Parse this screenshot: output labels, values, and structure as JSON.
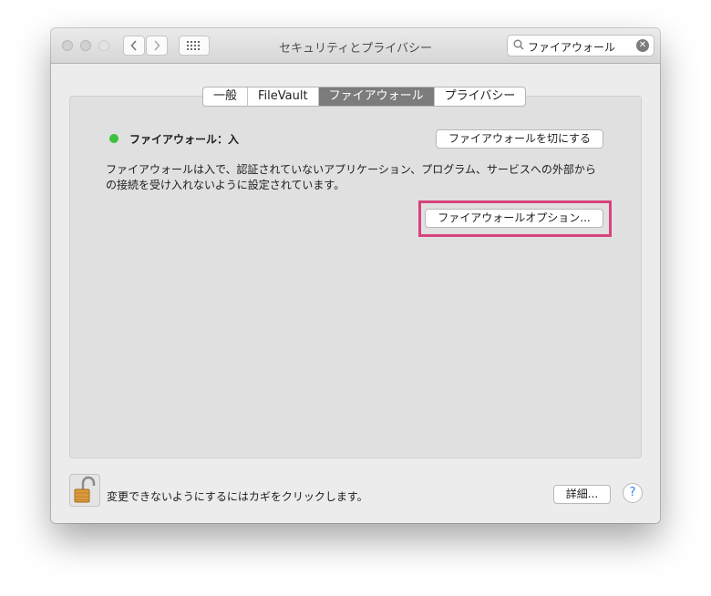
{
  "window": {
    "title": "セキュリティとプライバシー"
  },
  "search": {
    "value": "ファイアウォール"
  },
  "tabs": [
    {
      "label": "一般"
    },
    {
      "label": "FileVault"
    },
    {
      "label": "ファイアウォール",
      "active": true
    },
    {
      "label": "プライバシー"
    }
  ],
  "firewall": {
    "status": "ファイアウォール：入",
    "status_color": "#3ec13f",
    "toggle_button": "ファイアウォールを切にする",
    "description": "ファイアウォールは入で、認証されていないアプリケーション、プログラム、サービスへの外部からの接続を受け入れないように設定されています。",
    "options_button": "ファイアウォールオプション..."
  },
  "footer": {
    "lock_text": "変更できないようにするにはカギをクリックします。",
    "advanced_button": "詳細...",
    "help_label": "?"
  },
  "highlight_color": "#d8437d"
}
